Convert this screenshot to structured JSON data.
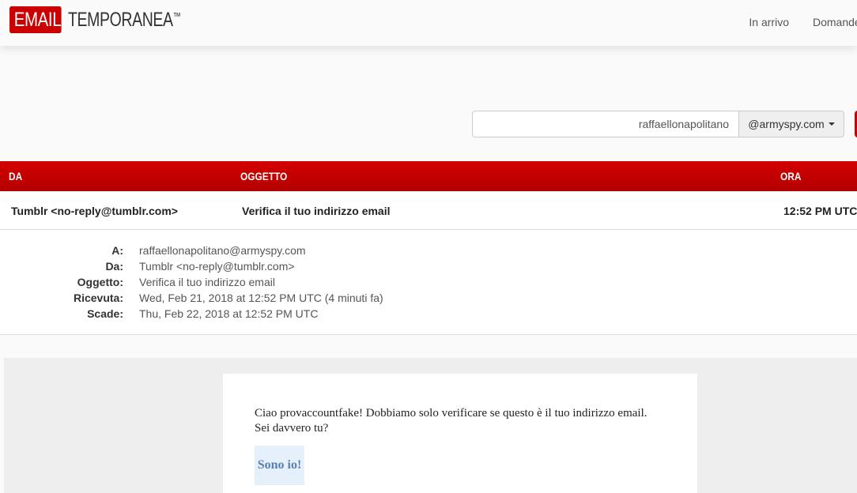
{
  "brand": {
    "box": "EMAIL",
    "name": "TEMPORANEA",
    "tm": "™"
  },
  "nav": {
    "inbox": "In arrivo",
    "faq": "Domande"
  },
  "address": {
    "username": "raffaellonapolitano",
    "domain": "@armyspy.com"
  },
  "inbox_header": {
    "from": "DA",
    "subject": "OGGETTO",
    "time": "ORA"
  },
  "message": {
    "from": "Tumblr <no-reply@tumblr.com>",
    "subject": "Verifica il tuo indirizzo email",
    "time": "12:52 PM UTC"
  },
  "details": [
    {
      "label": "A:",
      "value": "raffaellonapolitano@armyspy.com"
    },
    {
      "label": "Da:",
      "value": "Tumblr <no-reply@tumblr.com>"
    },
    {
      "label": "Oggetto:",
      "value": "Verifica il tuo indirizzo email"
    },
    {
      "label": "Ricevuta:",
      "value": "Wed, Feb 21, 2018 at 12:52 PM UTC (4 minuti fa)"
    },
    {
      "label": "Scade:",
      "value": "Thu, Feb 22, 2018 at 12:52 PM UTC"
    }
  ],
  "body": {
    "text": "Ciao provaccountfake! Dobbiamo solo verificare se questo è il tuo indirizzo email. Sei davvero tu?",
    "button": "Sono io!"
  },
  "colors": {
    "accent": "#cc0000",
    "header_gradient_top": "#d40000",
    "button_bg": "#e6f0fa",
    "button_text": "#5a7fb5"
  }
}
